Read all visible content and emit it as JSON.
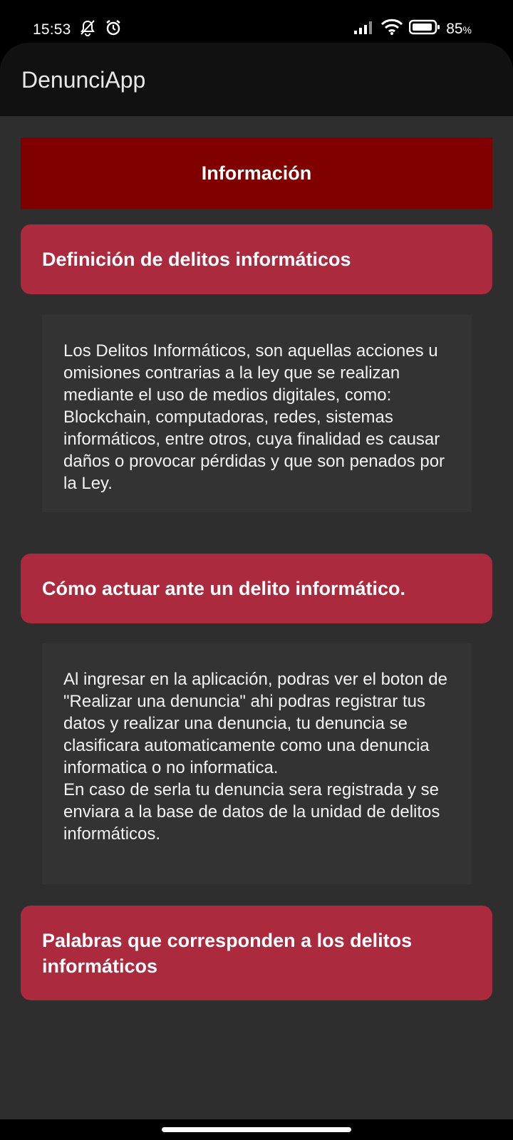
{
  "status": {
    "time": "15:53",
    "battery": "85",
    "battery_unit": "%",
    "icons": [
      "muted-notification-icon",
      "alarm-icon",
      "signal-icon",
      "wifi-icon",
      "battery-icon"
    ]
  },
  "app": {
    "title": "DenunciApp"
  },
  "info": {
    "title": "Información"
  },
  "sections": [
    {
      "title": "Definición de delitos informáticos",
      "body": "Los Delitos Informáticos, son aquellas acciones u omisiones contrarias a la ley que se realizan mediante el uso de medios digitales, como: Blockchain, computadoras, redes, sistemas informáticos, entre otros, cuya finalidad es causar daños o provocar pérdidas y que son penados por la Ley."
    },
    {
      "title": "Cómo actuar ante un delito informático.",
      "body": "Al ingresar en la aplicación, podras ver el boton de \"Realizar una denuncia\" ahi podras registrar tus datos y realizar una denuncia, tu denuncia se clasificara automaticamente como una denuncia informatica o no informatica.\nEn caso de serla tu denuncia sera registrada y se enviara a la base de datos de la unidad de delitos informáticos."
    },
    {
      "title": "Palabras que corresponden a los delitos informáticos"
    }
  ],
  "colors": {
    "info_header": "#800000",
    "section_header": "#ab2a3d",
    "content_bg": "#2e2e2e",
    "app_bar": "#111111"
  }
}
